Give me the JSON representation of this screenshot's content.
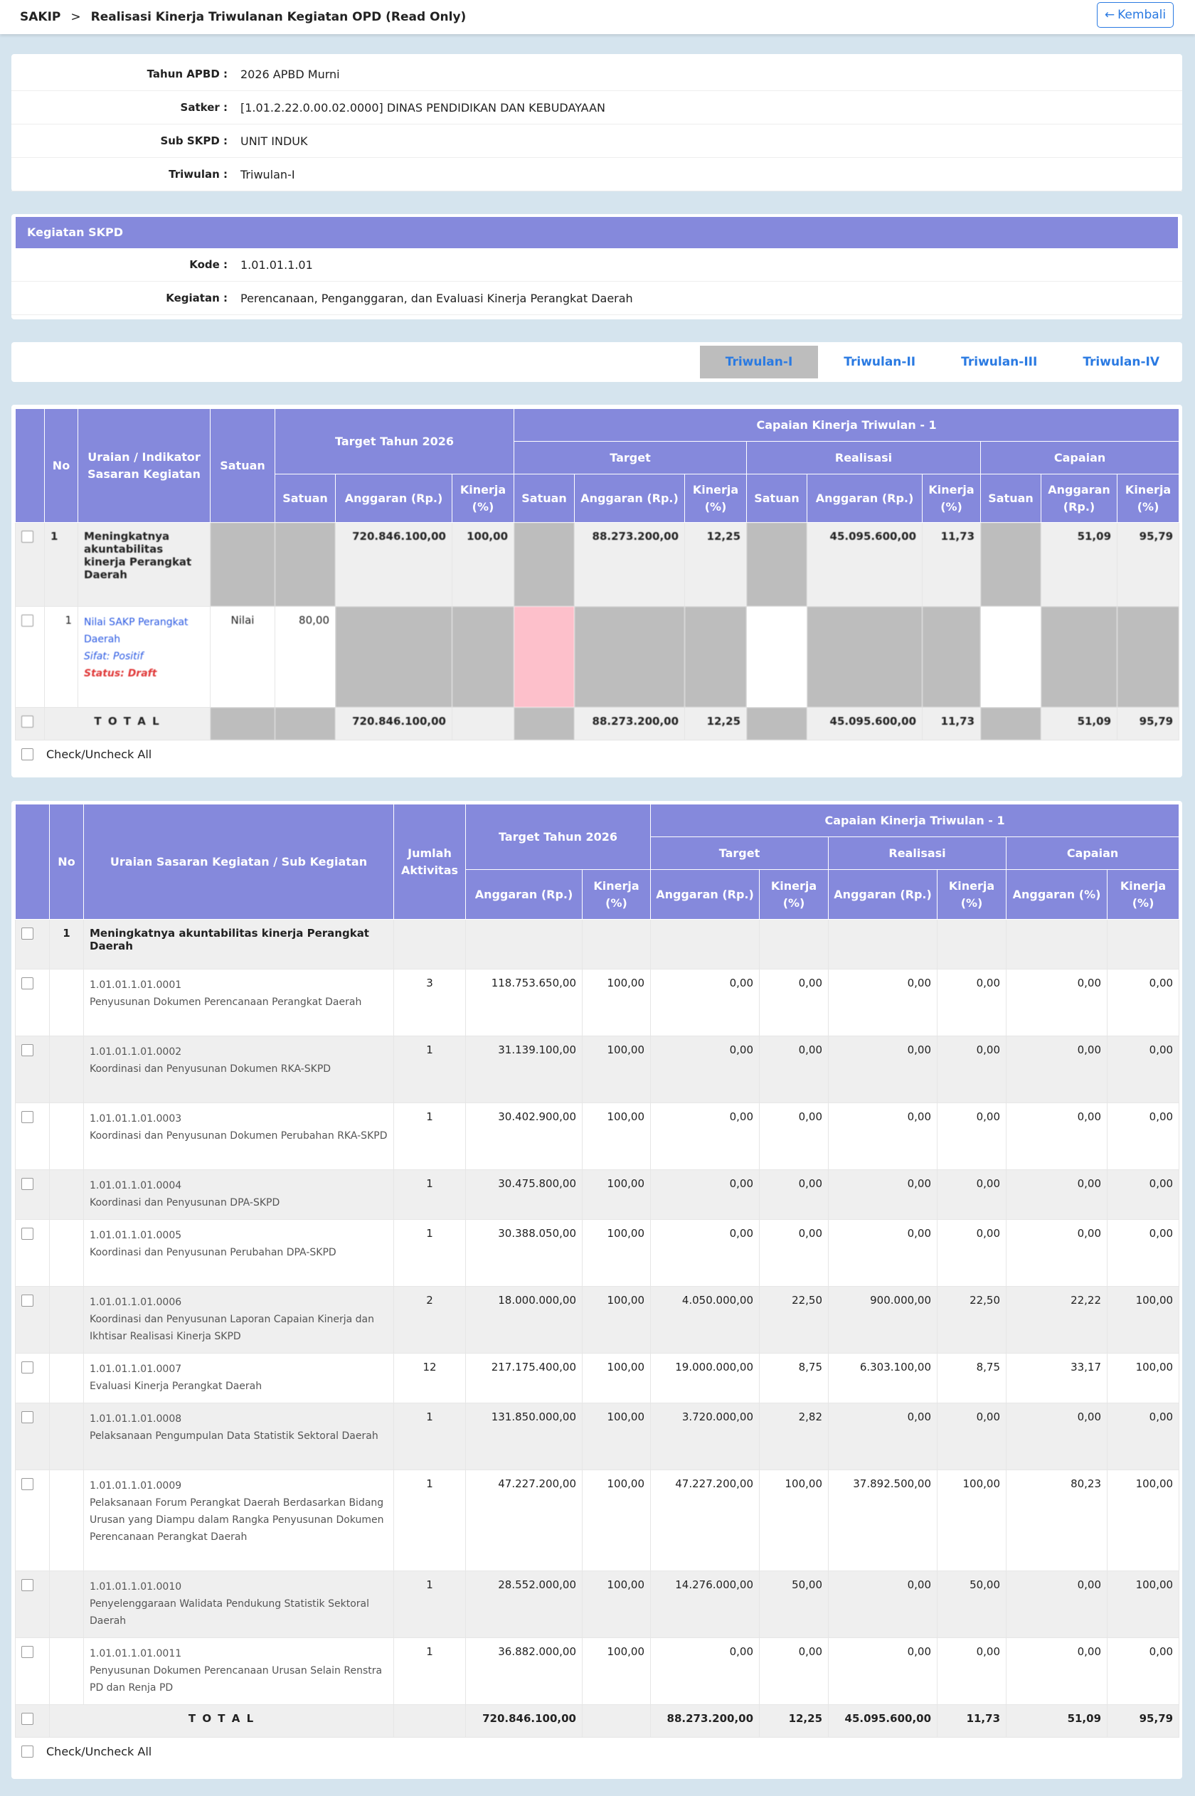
{
  "header": {
    "app": "SAKIP",
    "separator": ">",
    "title": "Realisasi Kinerja Triwulanan Kegiatan OPD (Read Only)",
    "back_label": "Kembali"
  },
  "info": [
    {
      "label": "Tahun APBD :",
      "value": "2026 APBD Murni"
    },
    {
      "label": "Satker :",
      "value": "[1.01.2.22.0.00.02.0000] DINAS PENDIDIKAN DAN KEBUDAYAAN"
    },
    {
      "label": "Sub SKPD :",
      "value": "UNIT INDUK"
    },
    {
      "label": "Triwulan :",
      "value": "Triwulan-I"
    }
  ],
  "kegiatan": {
    "title": "Kegiatan SKPD",
    "rows": [
      {
        "label": "Kode :",
        "value": "1.01.01.1.01"
      },
      {
        "label": "Kegiatan :",
        "value": "Perencanaan, Penganggaran, dan Evaluasi Kinerja Perangkat Daerah"
      }
    ]
  },
  "tabs": [
    "Triwulan-I",
    "Triwulan-II",
    "Triwulan-III",
    "Triwulan-IV"
  ],
  "table1": {
    "h_no": "No",
    "h_uraian": "Uraian / Indikator Sasaran Kegiatan",
    "h_satuan": "Satuan",
    "h_target_tahun": "Target Tahun 2026",
    "h_capaian_tw": "Capaian Kinerja Triwulan - 1",
    "h_target": "Target",
    "h_realisasi": "Realisasi",
    "h_capaian": "Capaian",
    "h_sub_satuan": "Satuan",
    "h_sub_anggaran": "Anggaran (Rp.)",
    "h_sub_kinerja": "Kinerja (%)",
    "row1": {
      "no": "1",
      "name": "Meningkatnya akuntabilitas kinerja Perangkat Daerah",
      "tt_anggaran": "720.846.100,00",
      "tt_kinerja": "100,00",
      "t_anggaran": "88.273.200,00",
      "t_kinerja": "12,25",
      "r_anggaran": "45.095.600,00",
      "r_kinerja": "11,73",
      "c_anggaran": "51,09",
      "c_kinerja": "95,79"
    },
    "row2": {
      "no": "1",
      "indikator": "Nilai SAKP Perangkat Daerah",
      "sifat": "Sifat: Positif",
      "status": "Status: Draft",
      "satuan": "Nilai",
      "target_satuan": "80,00"
    },
    "total": {
      "label": "T O T A L",
      "tt_anggaran": "720.846.100,00",
      "t_anggaran": "88.273.200,00",
      "t_kinerja": "12,25",
      "r_anggaran": "45.095.600,00",
      "r_kinerja": "11,73",
      "c_anggaran": "51,09",
      "c_kinerja": "95,79"
    },
    "check_all": "Check/Uncheck All"
  },
  "table2": {
    "h_no": "No",
    "h_uraian": "Uraian Sasaran Kegiatan / Sub Kegiatan",
    "h_jumlah": "Jumlah Aktivitas",
    "h_target_tahun": "Target Tahun 2026",
    "h_capaian_tw": "Capaian Kinerja Triwulan - 1",
    "h_target": "Target",
    "h_realisasi": "Realisasi",
    "h_capaian": "Capaian",
    "h_anggaran_rp": "Anggaran (Rp.)",
    "h_kinerja": "Kinerja (%)",
    "h_anggaran_pct": "Anggaran (%)",
    "group": {
      "no": "1",
      "name": "Meningkatnya akuntabilitas kinerja Perangkat Daerah"
    },
    "rows": [
      {
        "code": "1.01.01.1.01.0001",
        "name": "Penyusunan Dokumen Perencanaan Perangkat Daerah",
        "jumlah": "3",
        "tt_a": "118.753.650,00",
        "tt_k": "100,00",
        "t_a": "0,00",
        "t_k": "0,00",
        "r_a": "0,00",
        "r_k": "0,00",
        "c_a": "0,00",
        "c_k": "0,00"
      },
      {
        "code": "1.01.01.1.01.0002",
        "name": "Koordinasi dan Penyusunan Dokumen RKA-SKPD",
        "jumlah": "1",
        "tt_a": "31.139.100,00",
        "tt_k": "100,00",
        "t_a": "0,00",
        "t_k": "0,00",
        "r_a": "0,00",
        "r_k": "0,00",
        "c_a": "0,00",
        "c_k": "0,00"
      },
      {
        "code": "1.01.01.1.01.0003",
        "name": "Koordinasi dan Penyusunan Dokumen Perubahan RKA-SKPD",
        "jumlah": "1",
        "tt_a": "30.402.900,00",
        "tt_k": "100,00",
        "t_a": "0,00",
        "t_k": "0,00",
        "r_a": "0,00",
        "r_k": "0,00",
        "c_a": "0,00",
        "c_k": "0,00"
      },
      {
        "code": "1.01.01.1.01.0004",
        "name": "Koordinasi dan Penyusunan DPA-SKPD",
        "jumlah": "1",
        "tt_a": "30.475.800,00",
        "tt_k": "100,00",
        "t_a": "0,00",
        "t_k": "0,00",
        "r_a": "0,00",
        "r_k": "0,00",
        "c_a": "0,00",
        "c_k": "0,00"
      },
      {
        "code": "1.01.01.1.01.0005",
        "name": "Koordinasi dan Penyusunan Perubahan DPA-SKPD",
        "jumlah": "1",
        "tt_a": "30.388.050,00",
        "tt_k": "100,00",
        "t_a": "0,00",
        "t_k": "0,00",
        "r_a": "0,00",
        "r_k": "0,00",
        "c_a": "0,00",
        "c_k": "0,00"
      },
      {
        "code": "1.01.01.1.01.0006",
        "name": "Koordinasi dan Penyusunan Laporan Capaian Kinerja dan Ikhtisar Realisasi Kinerja SKPD",
        "jumlah": "2",
        "tt_a": "18.000.000,00",
        "tt_k": "100,00",
        "t_a": "4.050.000,00",
        "t_k": "22,50",
        "r_a": "900.000,00",
        "r_k": "22,50",
        "c_a": "22,22",
        "c_k": "100,00"
      },
      {
        "code": "1.01.01.1.01.0007",
        "name": "Evaluasi Kinerja Perangkat Daerah",
        "jumlah": "12",
        "tt_a": "217.175.400,00",
        "tt_k": "100,00",
        "t_a": "19.000.000,00",
        "t_k": "8,75",
        "r_a": "6.303.100,00",
        "r_k": "8,75",
        "c_a": "33,17",
        "c_k": "100,00"
      },
      {
        "code": "1.01.01.1.01.0008",
        "name": "Pelaksanaan Pengumpulan Data Statistik Sektoral Daerah",
        "jumlah": "1",
        "tt_a": "131.850.000,00",
        "tt_k": "100,00",
        "t_a": "3.720.000,00",
        "t_k": "2,82",
        "r_a": "0,00",
        "r_k": "0,00",
        "c_a": "0,00",
        "c_k": "0,00"
      },
      {
        "code": "1.01.01.1.01.0009",
        "name": "Pelaksanaan Forum Perangkat Daerah Berdasarkan Bidang Urusan yang Diampu dalam Rangka Penyusunan Dokumen Perencanaan Perangkat Daerah",
        "jumlah": "1",
        "tt_a": "47.227.200,00",
        "tt_k": "100,00",
        "t_a": "47.227.200,00",
        "t_k": "100,00",
        "r_a": "37.892.500,00",
        "r_k": "100,00",
        "c_a": "80,23",
        "c_k": "100,00"
      },
      {
        "code": "1.01.01.1.01.0010",
        "name": "Penyelenggaraan Walidata Pendukung Statistik Sektoral Daerah",
        "jumlah": "1",
        "tt_a": "28.552.000,00",
        "tt_k": "100,00",
        "t_a": "14.276.000,00",
        "t_k": "50,00",
        "r_a": "0,00",
        "r_k": "50,00",
        "c_a": "0,00",
        "c_k": "100,00"
      },
      {
        "code": "1.01.01.1.01.0011",
        "name": "Penyusunan Dokumen Perencanaan Urusan Selain Renstra PD dan Renja PD",
        "jumlah": "1",
        "tt_a": "36.882.000,00",
        "tt_k": "100,00",
        "t_a": "0,00",
        "t_k": "0,00",
        "r_a": "0,00",
        "r_k": "0,00",
        "c_a": "0,00",
        "c_k": "0,00"
      }
    ],
    "total": {
      "label": "T O T A L",
      "tt_a": "720.846.100,00",
      "t_a": "88.273.200,00",
      "t_k": "12,25",
      "r_a": "45.095.600,00",
      "r_k": "11,73",
      "c_a": "51,09",
      "c_k": "95,79"
    },
    "check_all": "Check/Uncheck All"
  }
}
